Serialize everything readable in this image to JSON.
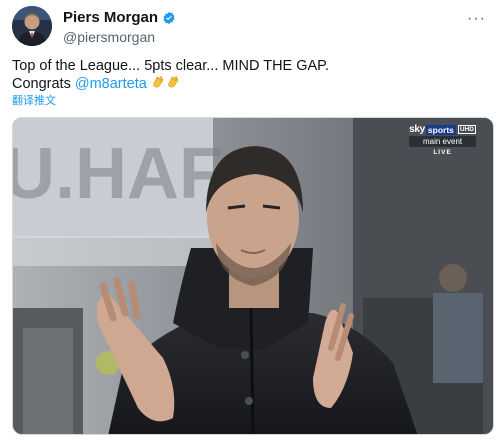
{
  "author": {
    "name": "Piers Morgan",
    "handle": "@piersmorgan",
    "avatar_icon": "person-avatar",
    "verified_icon": "verified-badge-icon",
    "verified_color": "#1d9bf0"
  },
  "tweet": {
    "line1": "Top of the League... 5pts clear... MIND THE GAP.",
    "line2_prefix": "Congrats ",
    "mention": "@m8arteta",
    "emoji_icon": "clapping-hands-emoji"
  },
  "translate_label": "翻译推文",
  "more_label": "···",
  "broadcast": {
    "brand": "sky",
    "channel": "sports",
    "quality": "UHD",
    "event": "main event",
    "status": "LIVE"
  },
  "colors": {
    "link": "#1d9bf0",
    "text": "#0f1419",
    "secondary": "#536471"
  }
}
